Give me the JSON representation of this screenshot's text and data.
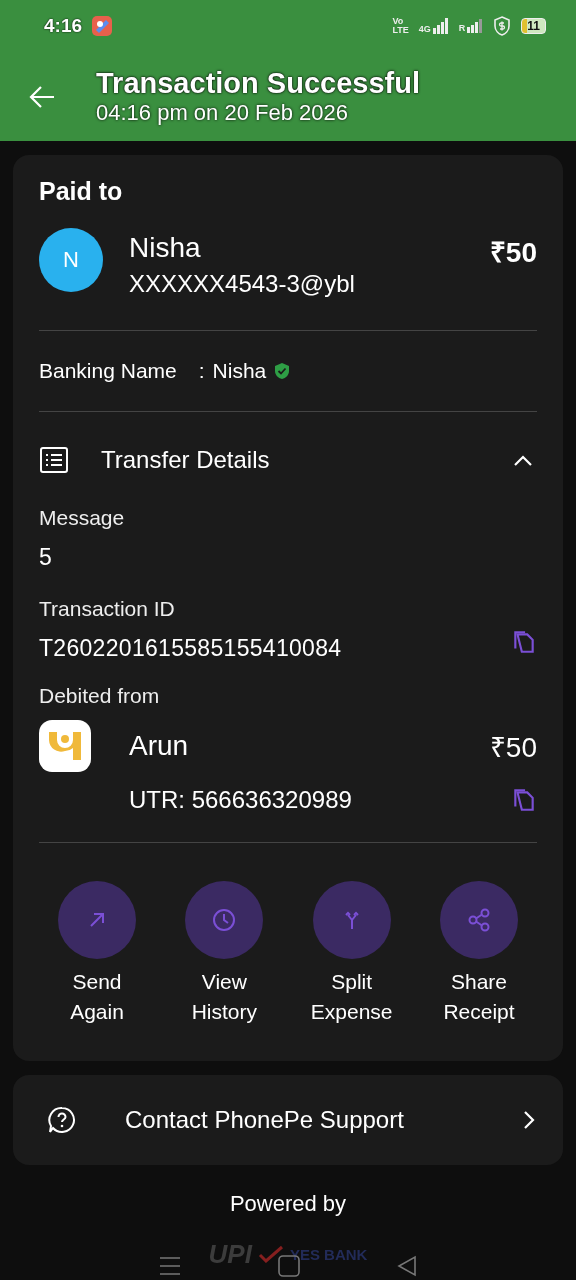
{
  "status_bar": {
    "time": "4:16",
    "volte_top": "Vo",
    "volte_bottom": "LTE",
    "network": "4G",
    "roaming": "R",
    "battery": "11"
  },
  "header": {
    "title": "Transaction Successful",
    "subtitle": "04:16 pm on 20 Feb 2026"
  },
  "paid_to": {
    "heading": "Paid to",
    "avatar": "N",
    "name": "Nisha",
    "upi_id": "XXXXXX4543-3@ybl",
    "amount": "₹50",
    "banking_label": "Banking Name",
    "separator": ":",
    "banking_name": "Nisha",
    "verified": true
  },
  "transfer_details": {
    "title": "Transfer Details",
    "expanded": true,
    "fields": [
      {
        "label": "Message",
        "value": "5",
        "copyable": false
      },
      {
        "label": "Transaction ID",
        "value": "T2602201615585155410084",
        "copyable": true
      }
    ],
    "debited_label": "Debited from",
    "account_name": "Arun",
    "account_amount": "₹50",
    "utr": "UTR: 566636320989"
  },
  "actions": [
    {
      "kind": "send",
      "label": "Send Again"
    },
    {
      "kind": "history",
      "label": "View History"
    },
    {
      "kind": "split",
      "label": "Split Expense"
    },
    {
      "kind": "share",
      "label": "Share Receipt"
    }
  ],
  "support": {
    "label": "Contact PhonePe Support"
  },
  "footer": {
    "powered_by": "Powered by",
    "logo_left": "UPI",
    "logo_right": "YES BANK"
  }
}
